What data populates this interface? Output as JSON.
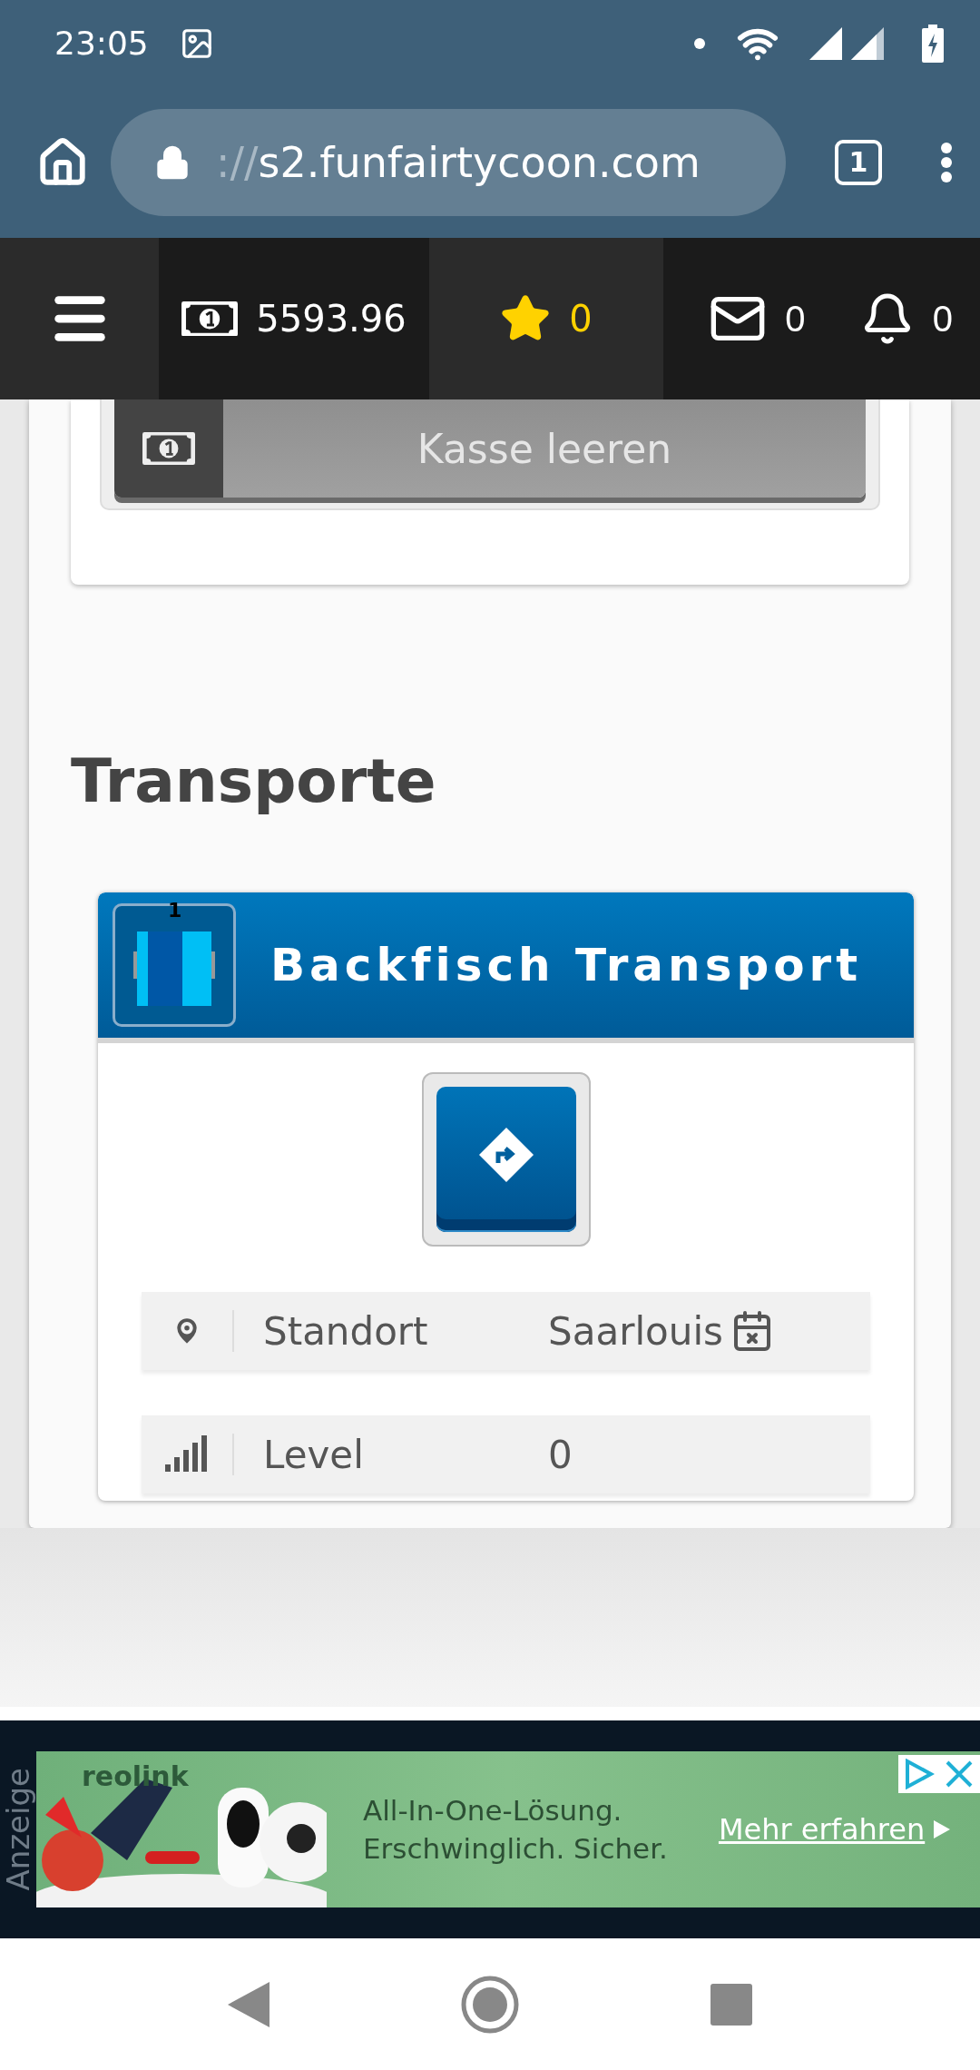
{
  "status_bar": {
    "time": "23:05"
  },
  "browser": {
    "url_scheme": "://",
    "url_host": "s2.funfairtycoon.com",
    "tab_count": "1"
  },
  "top_nav": {
    "money": "5593.96",
    "stars": "0",
    "messages": "0",
    "notifications": "0"
  },
  "cash_panel": {
    "button": "Kasse leeren"
  },
  "section_title": "Transporte",
  "transport": {
    "badge": "1",
    "title": "Backfisch Transport",
    "rows": [
      {
        "kind": "location",
        "label": "Standort",
        "value": "Saarlouis"
      },
      {
        "kind": "level",
        "label": "Level",
        "value": "0"
      }
    ]
  },
  "ad": {
    "label": "Anzeige",
    "brand": "reolink",
    "headline": "All-In-One-Lösung.",
    "subline": "Erschwinglich. Sicher.",
    "cta": "Mehr erfahren"
  }
}
